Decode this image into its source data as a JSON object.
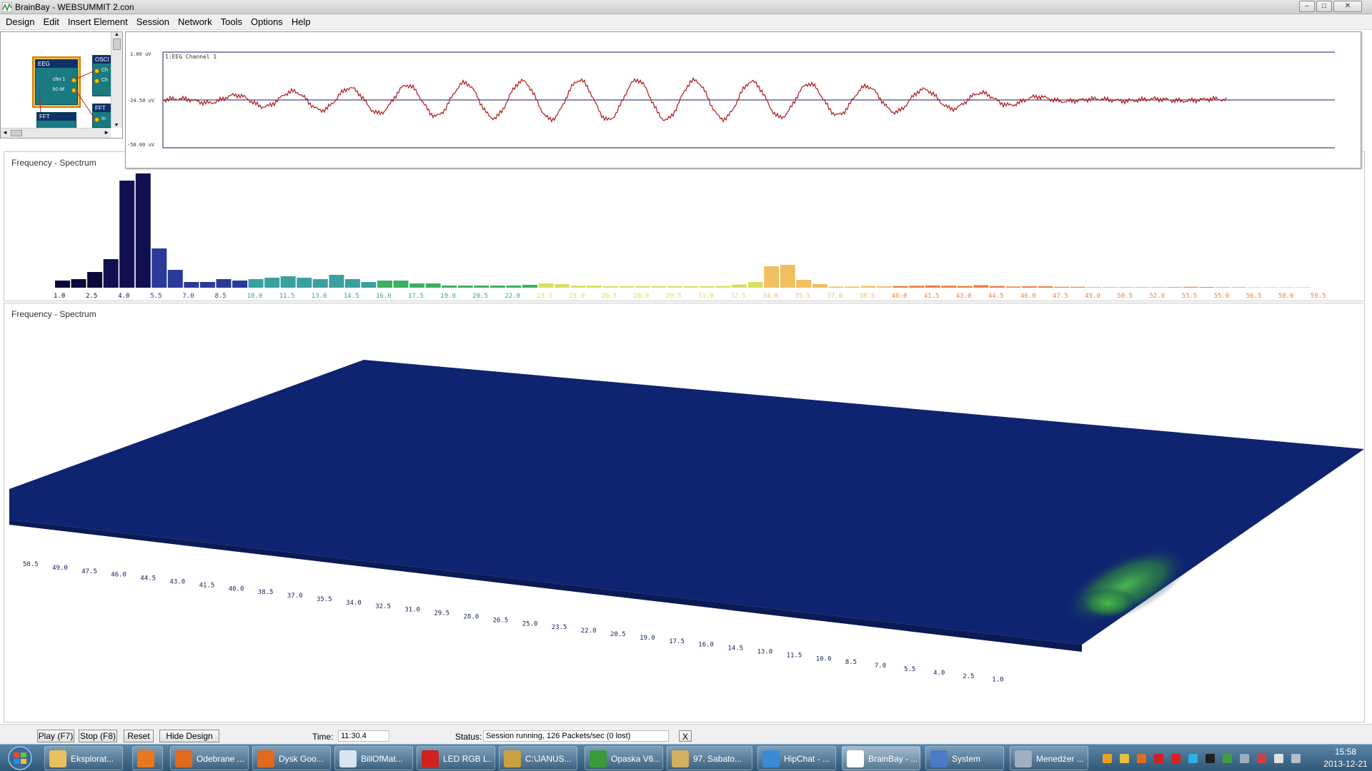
{
  "window": {
    "title": "BrainBay - WEBSUMMIT 2.con",
    "minimize": "–",
    "maximize": "□",
    "close": "✕"
  },
  "menu": [
    "Design",
    "Edit",
    "Insert Element",
    "Session",
    "Network",
    "Tools",
    "Options",
    "Help"
  ],
  "design": {
    "eeg_node": {
      "title": "EEG",
      "ports": [
        "chn 1",
        "b1-bf"
      ]
    },
    "osc_node": {
      "title": "OSCI",
      "ports": [
        "Ch",
        "Ch"
      ]
    },
    "fft_node_1": {
      "title": "FFT"
    },
    "fft_node_2": {
      "title": "FFT",
      "ports": [
        "In"
      ]
    },
    "scroll_left": "◄",
    "scroll_right": "►",
    "scroll_up": "▲",
    "scroll_down": "▼"
  },
  "oscilloscope": {
    "channel_label": "1:EEG Channel 1",
    "y_labels": [
      "1.00 uV",
      "-24.50 uV",
      "-50.00 uV"
    ],
    "trace_color": "#b01818",
    "axis_color": "#1a1a6a"
  },
  "spectrum_2d": {
    "caption": "Frequency - Spectrum",
    "freq_labels": [
      "1.0",
      "2.5",
      "4.0",
      "5.5",
      "7.0",
      "8.5",
      "10.0",
      "11.5",
      "13.0",
      "14.5",
      "16.0",
      "17.5",
      "19.0",
      "20.5",
      "22.0",
      "23.5",
      "25.0",
      "26.5",
      "28.0",
      "29.5",
      "31.0",
      "32.5",
      "34.0",
      "35.5",
      "37.0",
      "38.5",
      "40.0",
      "41.5",
      "43.0",
      "44.5",
      "46.0",
      "47.5",
      "49.0",
      "50.5",
      "52.0",
      "53.5",
      "55.0",
      "56.5",
      "58.0",
      "59.5"
    ]
  },
  "spectrum_3d": {
    "caption": "Frequency - Spectrum",
    "surface_color": "#0e2470",
    "highlight_color": "#2e9a2e",
    "freq_labels": [
      "50.5",
      "49.0",
      "47.5",
      "46.0",
      "44.5",
      "43.0",
      "41.5",
      "40.0",
      "38.5",
      "37.0",
      "35.5",
      "34.0",
      "32.5",
      "31.0",
      "29.5",
      "28.0",
      "26.5",
      "25.0",
      "23.5",
      "22.0",
      "20.5",
      "19.0",
      "17.5",
      "16.0",
      "14.5",
      "13.0",
      "11.5",
      "10.0",
      "8.5",
      "7.0",
      "5.5",
      "4.0",
      "2.5",
      "1.0"
    ]
  },
  "controls": {
    "play": "Play (F7)",
    "stop": "Stop (F8)",
    "reset": "Reset",
    "hide_design": "Hide Design",
    "time_label": "Time:",
    "time_value": "11:30.4",
    "status_label": "Status:",
    "status_value": "Session running,  126 Packets/sec (0 lost)",
    "close_status": "X"
  },
  "taskbar": {
    "items": [
      {
        "label": "Eksplorat...",
        "icon": "folder-icon",
        "color": "#e8c060"
      },
      {
        "label": "",
        "icon": "media-player-icon",
        "color": "#e87820"
      },
      {
        "label": "Odebrane ...",
        "icon": "firefox-icon",
        "color": "#e06a20"
      },
      {
        "label": "Dysk Goo...",
        "icon": "firefox-icon",
        "color": "#e06a20"
      },
      {
        "label": "BillOfMat...",
        "icon": "notepad-icon",
        "color": "#d8e4f0"
      },
      {
        "label": "LED RGB L...",
        "icon": "pdf-icon",
        "color": "#d02020"
      },
      {
        "label": "C:\\JANUS...",
        "icon": "pads-icon",
        "color": "#c8a040"
      },
      {
        "label": "Opaska V6...",
        "icon": "pads-icon",
        "color": "#3a9a3a"
      },
      {
        "label": "97. Sabato...",
        "icon": "winamp-icon",
        "color": "#d0b060"
      },
      {
        "label": "HipChat - ...",
        "icon": "hipchat-icon",
        "color": "#3a8ad8"
      },
      {
        "label": "BrainBay - ...",
        "icon": "brainbay-icon",
        "color": "#ffffff"
      },
      {
        "label": "System",
        "icon": "system-icon",
        "color": "#4a7ac8"
      },
      {
        "label": "Menedżer ...",
        "icon": "task-manager-icon",
        "color": "#a0b0c0"
      }
    ],
    "clock_time": "15:58",
    "clock_date": "2013-12-21"
  }
}
